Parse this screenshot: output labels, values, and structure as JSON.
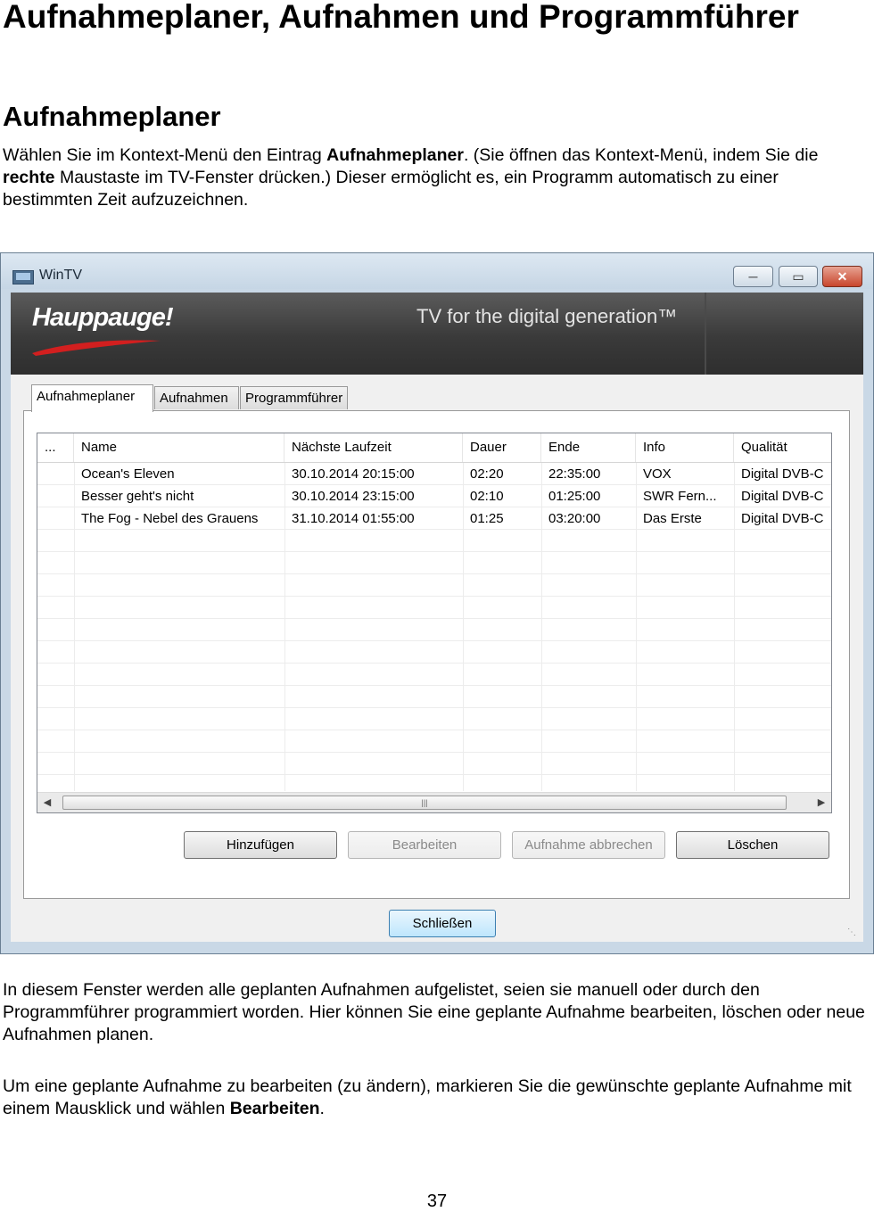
{
  "heading1": "Aufnahmeplaner, Aufnahmen und Programmführer",
  "heading2": "Aufnahmeplaner",
  "para1": {
    "t1": "Wählen Sie im Kontext-Menü den Eintrag ",
    "b1": "Aufnahmeplaner",
    "t2": ". (Sie öffnen das Kontext-Menü, indem Sie die ",
    "b2": "rechte",
    "t3": " Maustaste im TV-Fenster drücken.) Dieser ermöglicht es, ein Programm automatisch zu einer bestimmten Zeit aufzuzeichnen."
  },
  "window": {
    "title": "WinTV",
    "logo": "Hauppauge!",
    "tagline": "TV for the digital generation™",
    "tabs": [
      "Aufnahmeplaner",
      "Aufnahmen",
      "Programmführer"
    ],
    "columns": [
      "...",
      "Name",
      "Nächste Laufzeit",
      "Dauer",
      "Ende",
      "Info",
      "Qualität"
    ],
    "rows": [
      [
        "",
        "Ocean's Eleven",
        "30.10.2014 20:15:00",
        "02:20",
        "22:35:00",
        "VOX",
        "Digital DVB-C"
      ],
      [
        "",
        "Besser geht's nicht",
        "30.10.2014 23:15:00",
        "02:10",
        "01:25:00",
        "SWR Fern...",
        "Digital DVB-C"
      ],
      [
        "",
        "The Fog - Nebel des Grauens",
        "31.10.2014 01:55:00",
        "01:25",
        "03:20:00",
        "Das Erste",
        "Digital DVB-C"
      ]
    ],
    "buttons": {
      "add": "Hinzufügen",
      "edit": "Bearbeiten",
      "cancel_recording": "Aufnahme abbrechen",
      "delete": "Löschen",
      "close": "Schließen"
    }
  },
  "para2": "In diesem Fenster werden alle geplanten Aufnahmen aufgelistet, seien sie manuell oder durch den Programmführer programmiert worden. Hier können Sie eine geplante Aufnahme bearbeiten, löschen oder neue Aufnahmen planen.",
  "para3": {
    "t1": "Um eine geplante Aufnahme zu bearbeiten (zu ändern), markieren Sie die gewünschte geplante Aufnahme mit einem Mausklick und wählen ",
    "b1": "Bearbeiten",
    "t2": "."
  },
  "page_number": "37"
}
